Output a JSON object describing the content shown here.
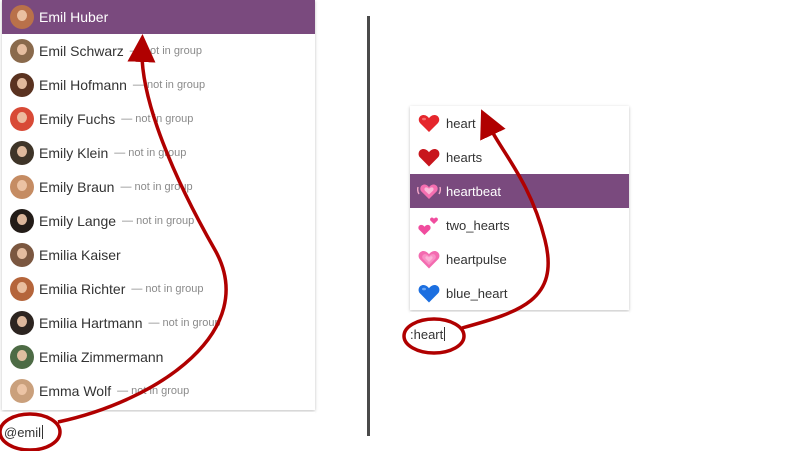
{
  "mention_popup": {
    "items": [
      {
        "name": "Emil Huber",
        "note": "",
        "selected": true,
        "avatar_color": "#b9714a"
      },
      {
        "name": "Emil Schwarz",
        "note": "— not in group",
        "selected": false,
        "avatar_color": "#8a6a4c"
      },
      {
        "name": "Emil Hofmann",
        "note": "— not in group",
        "selected": false,
        "avatar_color": "#5a3220"
      },
      {
        "name": "Emily Fuchs",
        "note": "— not in group",
        "selected": false,
        "avatar_color": "#d84a36"
      },
      {
        "name": "Emily Klein",
        "note": "— not in group",
        "selected": false,
        "avatar_color": "#3e3428"
      },
      {
        "name": "Emily Braun",
        "note": "— not in group",
        "selected": false,
        "avatar_color": "#c58c63"
      },
      {
        "name": "Emily Lange",
        "note": "— not in group",
        "selected": false,
        "avatar_color": "#231c18"
      },
      {
        "name": "Emilia Kaiser",
        "note": "",
        "selected": false,
        "avatar_color": "#7b5740"
      },
      {
        "name": "Emilia Richter",
        "note": "— not in group",
        "selected": false,
        "avatar_color": "#b5653b"
      },
      {
        "name": "Emilia Hartmann",
        "note": "— not in group",
        "selected": false,
        "avatar_color": "#2c2420"
      },
      {
        "name": "Emilia Zimmermann",
        "note": "",
        "selected": false,
        "avatar_color": "#4d6b45"
      },
      {
        "name": "Emma Wolf",
        "note": "— not in group",
        "selected": false,
        "avatar_color": "#caa07c"
      }
    ],
    "input_value": "@emil"
  },
  "emoji_popup": {
    "items": [
      {
        "label": "heart",
        "icon": "red-heart-icon",
        "selected": false
      },
      {
        "label": "hearts",
        "icon": "hearts-suit-icon",
        "selected": false
      },
      {
        "label": "heartbeat",
        "icon": "beating-heart-icon",
        "selected": true
      },
      {
        "label": "two_hearts",
        "icon": "two-hearts-icon",
        "selected": false
      },
      {
        "label": "heartpulse",
        "icon": "growing-heart-icon",
        "selected": false
      },
      {
        "label": "blue_heart",
        "icon": "blue-heart-icon",
        "selected": false
      }
    ],
    "input_value": ":heart"
  },
  "colors": {
    "selection": "#7a4a7e",
    "annotation": "#b00000",
    "divider": "#4a4a4a"
  }
}
